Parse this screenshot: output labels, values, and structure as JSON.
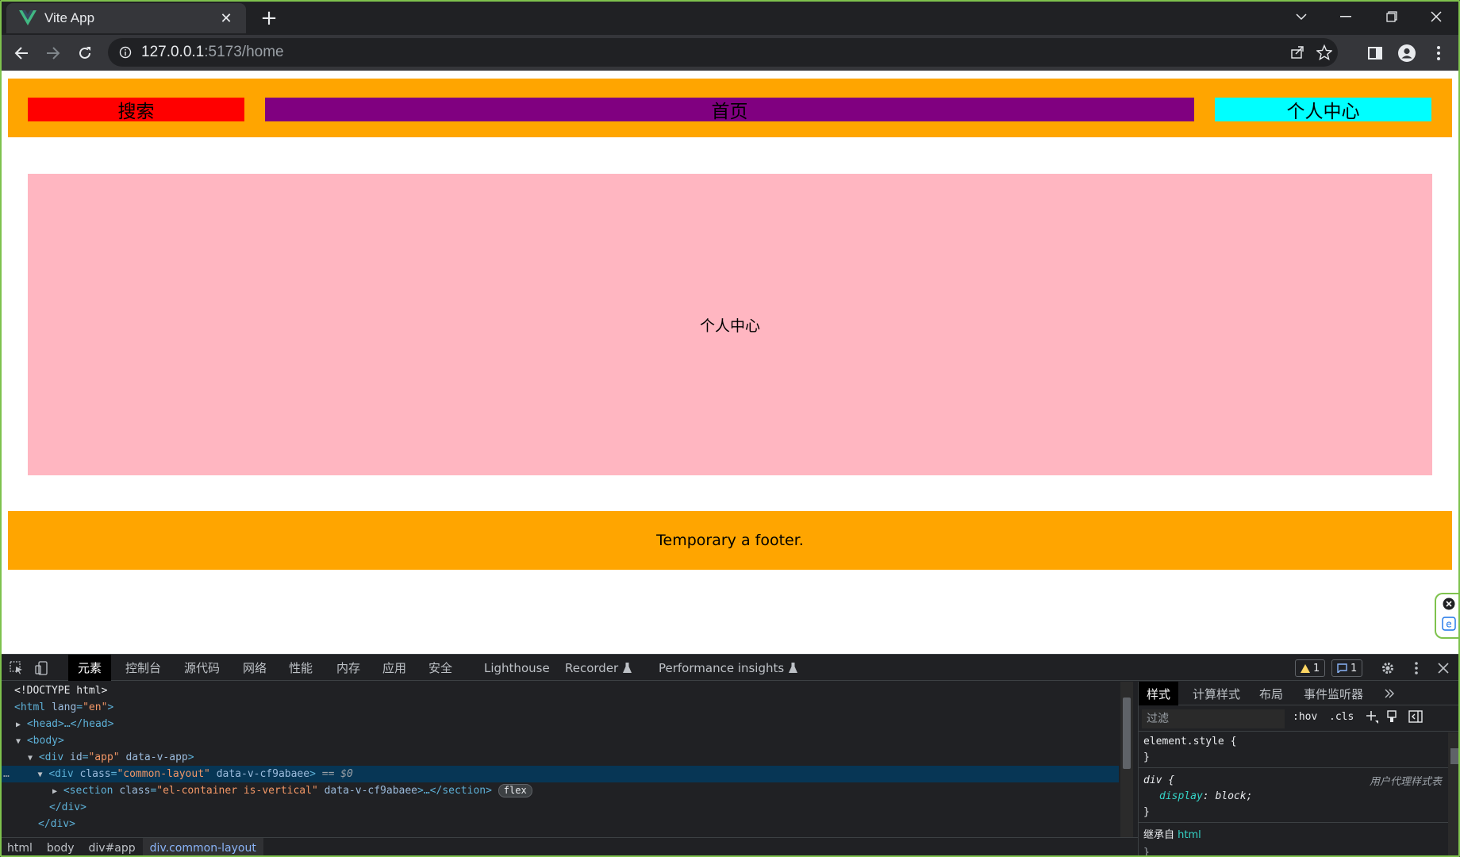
{
  "browser": {
    "tab_title": "Vite App",
    "url_host": "127.0.0.1",
    "url_rest": ":5173/home",
    "accent": "#7ec24d"
  },
  "page": {
    "header": {
      "search_label": "搜索",
      "home_label": "首页",
      "user_label": "个人中心"
    },
    "main_text": "个人中心",
    "footer_text": "Temporary a footer.",
    "colors": {
      "header_bg": "#ffa500",
      "search_bg": "#ff0000",
      "home_bg": "#800080",
      "user_bg": "#00ffff",
      "main_bg": "#ffb6c1"
    }
  },
  "devtools": {
    "tabs": [
      "元素",
      "控制台",
      "源代码",
      "网络",
      "性能",
      "内存",
      "应用",
      "安全",
      "Lighthouse",
      "Recorder",
      "Performance insights"
    ],
    "warning_count": "1",
    "message_count": "1",
    "dom": {
      "doctype": "<!DOCTYPE html>",
      "html_open": "<html",
      "html_attr": "lang",
      "html_val": "\"en\"",
      "head": "<head>…</head>",
      "body": "<body>",
      "app_tag": "<div",
      "app_attr_id": "id",
      "app_id_val": "\"app\"",
      "app_attr_extra": "data-v-app",
      "layout_tag": "<div",
      "layout_attr_class": "class",
      "layout_class_val": "\"common-layout\"",
      "layout_attr_extra": "data-v-cf9abaee",
      "layout_ref": "== $0",
      "section_tag": "<section",
      "section_attr_class": "class",
      "section_class_val": "\"el-container is-vertical\"",
      "section_attr_extra": "data-v-cf9abaee",
      "section_close": ">…</section>",
      "flex_pill": "flex",
      "div_close": "</div>",
      "div_close_2": "</div>",
      "ellipsis": "…"
    },
    "breadcrumbs": [
      "html",
      "body",
      "div#app",
      "div.common-layout"
    ],
    "styles": {
      "tabs": [
        "样式",
        "计算样式",
        "布局",
        "事件监听器"
      ],
      "filter_placeholder": "过滤",
      "hov": ":hov",
      "cls": ".cls",
      "element_style": "element.style {",
      "close_brace": "}",
      "div_rule": "div {",
      "ua_label": "用户代理样式表",
      "prop_name": "display",
      "prop_value": ": block;",
      "close_brace_2": "}",
      "inherited_label": "继承自",
      "inherited_from": "html",
      "close_brace_3": "}"
    }
  }
}
